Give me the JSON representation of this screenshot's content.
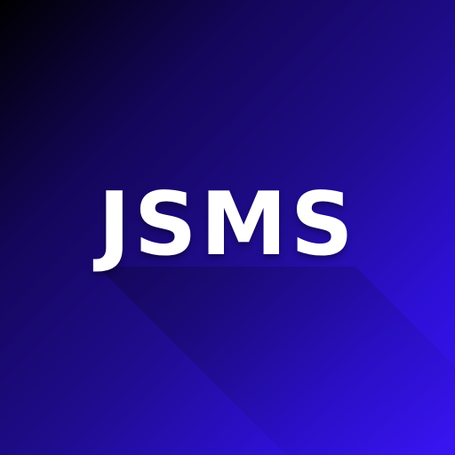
{
  "logo": {
    "text": "JSMS",
    "text_color": "#ffffff",
    "gradient": [
      "#000000",
      "#14065a",
      "#1f0c8e",
      "#2d10d6",
      "#3a14f5"
    ]
  }
}
